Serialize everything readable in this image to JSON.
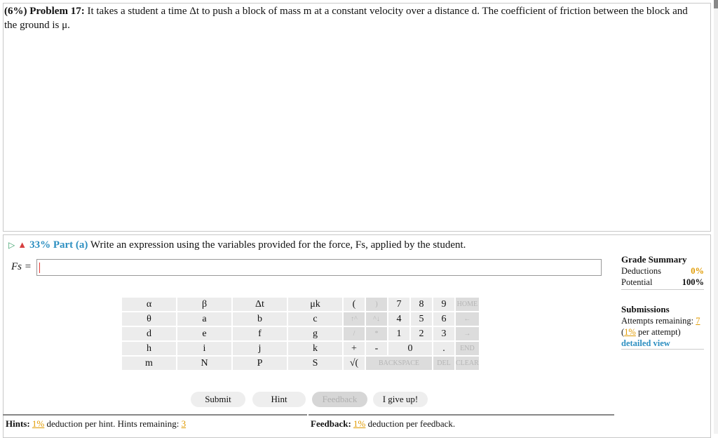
{
  "problem": {
    "weight": "(6%)",
    "title": "Problem 17:",
    "text": "It takes a student a time Δt to push a block of mass m at a constant velocity over a distance d. The coefficient of friction between the block and the ground is μ."
  },
  "part": {
    "percent": "33% Part (a)",
    "text": "Write an expression using the variables provided for the force, Fs, applied by the student."
  },
  "answer": {
    "label": "Fs =",
    "value": ""
  },
  "keypad": {
    "vars": [
      [
        "α",
        "β",
        "Δt",
        "μk"
      ],
      [
        "θ",
        "a",
        "b",
        "c"
      ],
      [
        "d",
        "e",
        "f",
        "g"
      ],
      [
        "h",
        "i",
        "j",
        "k"
      ],
      [
        "m",
        "N",
        "P",
        "S"
      ]
    ],
    "ops": {
      "open_paren": "(",
      "close_paren": ")",
      "up": "↑^",
      "down": "^↓",
      "divide": "/",
      "multiply": "*",
      "plus": "+",
      "minus": "-",
      "sqrt": "√(",
      "backspace": "BACKSPACE",
      "del": "DEL",
      "clear": "CLEAR",
      "home": "HOME",
      "left": "←",
      "right": "→",
      "end": "END",
      "dot": "."
    },
    "digits": [
      "7",
      "8",
      "9",
      "4",
      "5",
      "6",
      "1",
      "2",
      "3",
      "0"
    ]
  },
  "buttons": {
    "submit": "Submit",
    "hint": "Hint",
    "feedback": "Feedback",
    "give_up": "I give up!"
  },
  "hints": {
    "label": "Hints:",
    "deduction": "1%",
    "text": "deduction per hint. Hints remaining:",
    "remaining": "3"
  },
  "feedback": {
    "label": "Feedback:",
    "deduction": "1%",
    "text": "deduction per feedback."
  },
  "grade_summary": {
    "title": "Grade Summary",
    "deductions_label": "Deductions",
    "deductions_value": "0%",
    "potential_label": "Potential",
    "potential_value": "100%"
  },
  "submissions": {
    "title": "Submissions",
    "attempts_label": "Attempts remaining:",
    "attempts_value": "7",
    "per_attempt_open": "(",
    "per_attempt_pct": "1%",
    "per_attempt_text": "per attempt)",
    "detailed_view": "detailed view"
  }
}
